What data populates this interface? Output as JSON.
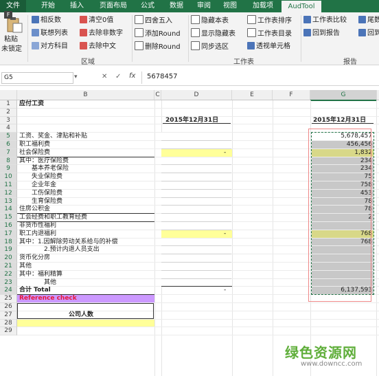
{
  "ribbon": {
    "tabs": [
      "文件",
      "开始",
      "插入",
      "页面布局",
      "公式",
      "数据",
      "审阅",
      "视图",
      "加载项",
      "AudTool"
    ],
    "active_tab": "AudTool",
    "file_badge": "F",
    "big_button": {
      "line1": "粘贴",
      "line2": "未锁定"
    },
    "buttons": {
      "reverse_sign": "相反数",
      "linked_list": "联想列表",
      "opposite_subject": "对方科目",
      "clear_zero": "清空0值",
      "remove_nonnumeric": "去除非数字",
      "remove_chinese": "去除中文",
      "round_half": "四舍五入",
      "add_round": "添加Round",
      "delete_round": "删除Round",
      "hide_sheet": "隐藏本表",
      "show_hidden": "显示隐藏表",
      "sync_select": "同步选区",
      "sheet_sort": "工作表排序",
      "sheet_index": "工作表目录",
      "pivot_cell": "透视单元格",
      "sheet_compare": "工作表比较",
      "back_to_report": "回到报告",
      "tail_number": "尾数",
      "back_partial": "回到"
    },
    "groups": {
      "area": "区域",
      "worksheet": "工作表",
      "report": "报告"
    }
  },
  "formula_bar": {
    "name_box": "G5",
    "fx": "fx",
    "value": "5678457"
  },
  "columns": [
    "B",
    "C",
    "D",
    "E",
    "F",
    "G"
  ],
  "rows": [
    {
      "n": "1",
      "b": "应付工资",
      "d": "",
      "g": ""
    },
    {
      "n": "2",
      "b": "",
      "d": "",
      "g": ""
    },
    {
      "n": "3",
      "b": "",
      "d": "2015年12月31日",
      "g": "2015年12月31日"
    },
    {
      "n": "4",
      "b": "",
      "d": "",
      "g": ""
    },
    {
      "n": "5",
      "b": "工资、奖金、津贴和补贴",
      "d": "",
      "g": "5,678,457"
    },
    {
      "n": "6",
      "b": "职工福利费",
      "d": "",
      "g": "456,456"
    },
    {
      "n": "7",
      "b": "社会保险费",
      "d": "-",
      "g": "1,832"
    },
    {
      "n": "8",
      "b": "其中：医疗保险费",
      "d": "",
      "g": "234"
    },
    {
      "n": "9",
      "b": "基本养老保险",
      "d": "",
      "g": "234"
    },
    {
      "n": "10",
      "b": "失业保险费",
      "d": "",
      "g": "75"
    },
    {
      "n": "11",
      "b": "企业年金",
      "d": "",
      "g": "758"
    },
    {
      "n": "12",
      "b": "工伤保险费",
      "d": "",
      "g": "453"
    },
    {
      "n": "13",
      "b": "生育保险费",
      "d": "",
      "g": "78"
    },
    {
      "n": "14",
      "b": "住房公积金",
      "d": "",
      "g": "78"
    },
    {
      "n": "15",
      "b": "工会经费和职工教育经费",
      "d": "",
      "g": "2"
    },
    {
      "n": "16",
      "b": "非货币性福利",
      "d": "",
      "g": ""
    },
    {
      "n": "17",
      "b": "职工内退福利",
      "d": "-",
      "g": "768"
    },
    {
      "n": "18",
      "b": "其中：1.因解除劳动关系给与的补偿",
      "d": "",
      "g": "768"
    },
    {
      "n": "19",
      "b": "2.预计内退人员支出",
      "d": "",
      "g": ""
    },
    {
      "n": "20",
      "b": "货币化分房",
      "d": "",
      "g": ""
    },
    {
      "n": "21",
      "b": "其他",
      "d": "",
      "g": ""
    },
    {
      "n": "22",
      "b": "其中：福利精算",
      "d": "",
      "g": ""
    },
    {
      "n": "23",
      "b": "其他",
      "d": "",
      "g": ""
    },
    {
      "n": "24",
      "b": "合计 Total",
      "d": "-",
      "g": "6,137,593"
    },
    {
      "n": "25",
      "b": "Reference check",
      "d": "",
      "g": ""
    },
    {
      "n": "26",
      "b": "",
      "d": "",
      "g": ""
    },
    {
      "n": "27",
      "b": "公司人数",
      "d": "",
      "g": ""
    },
    {
      "n": "28",
      "b": "",
      "d": "",
      "g": ""
    },
    {
      "n": "29",
      "b": "",
      "d": "",
      "g": ""
    }
  ],
  "watermark": {
    "title": "绿色资源网",
    "url": "www.downcc.com"
  },
  "colors": {
    "ribbon_green": "#217346",
    "yellow": "#ffff99",
    "purple": "#cc99ff",
    "reference_red": "#e8173c",
    "selection_gray": "#c8c8c8"
  }
}
